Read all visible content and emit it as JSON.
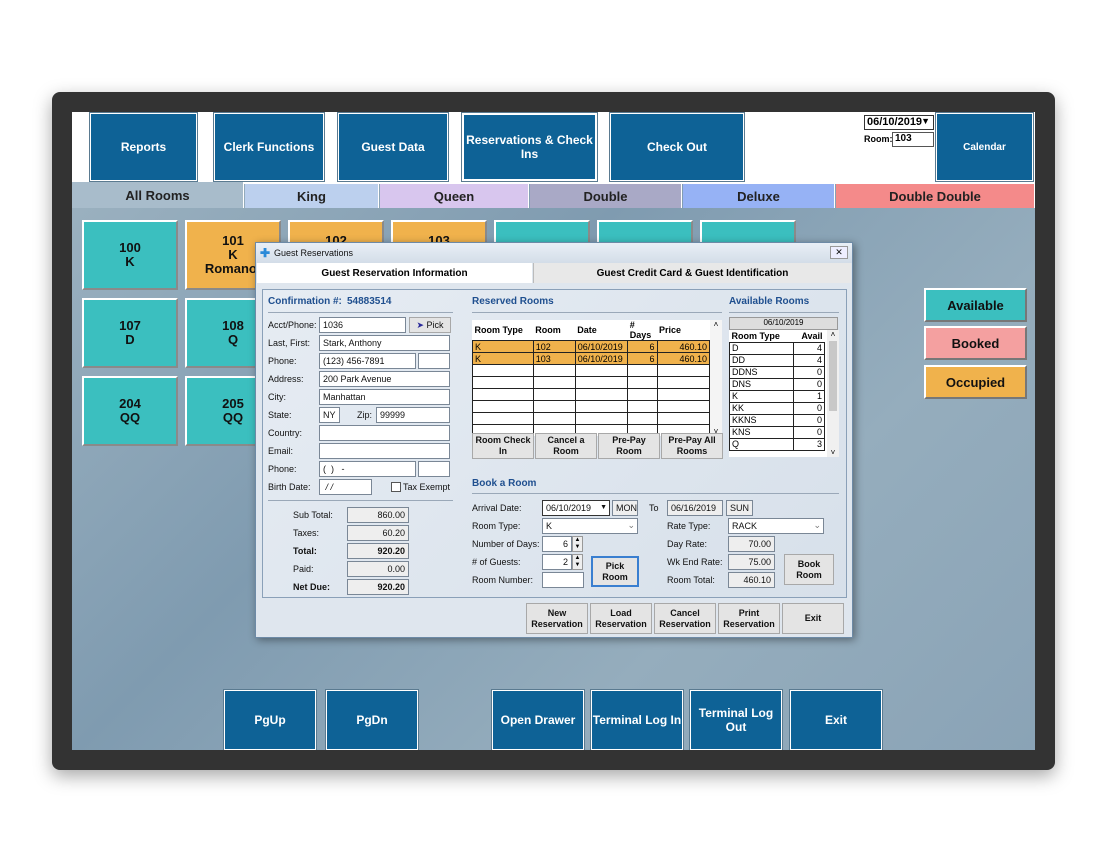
{
  "top_buttons": [
    "Reports",
    "Clerk Functions",
    "Guest Data",
    "Reservations & Check Ins",
    "Check Out"
  ],
  "date_select": "06/10/2019",
  "room_label": "Room:",
  "room_value": "103",
  "calendar": "Calendar",
  "tabs": [
    {
      "label": "All Rooms",
      "color": "#a8bccb"
    },
    {
      "label": "King",
      "color": "#bcd0ee"
    },
    {
      "label": "Queen",
      "color": "#d8c6ee"
    },
    {
      "label": "Double",
      "color": "#a9a9c6"
    },
    {
      "label": "Deluxe",
      "color": "#96b2f5"
    },
    {
      "label": "Double Double",
      "color": "#f48a8a"
    }
  ],
  "rooms": [
    {
      "number": "100",
      "type": "K",
      "guest": "",
      "status": "available"
    },
    {
      "number": "101",
      "type": "K",
      "guest": "Romanof",
      "status": "occupied"
    },
    {
      "number": "102",
      "type": "",
      "guest": "",
      "status": "occupied"
    },
    {
      "number": "103",
      "type": "",
      "guest": "",
      "status": "occupied"
    },
    {
      "number": "",
      "type": "",
      "guest": "",
      "status": "available"
    },
    {
      "number": "",
      "type": "",
      "guest": "",
      "status": "available"
    },
    {
      "number": "",
      "type": "",
      "guest": "",
      "status": "available"
    },
    {
      "number": "107",
      "type": "D",
      "guest": "",
      "status": "available"
    },
    {
      "number": "108",
      "type": "Q",
      "guest": "",
      "status": "available"
    },
    {
      "number": "204",
      "type": "QQ",
      "guest": "",
      "status": "available"
    },
    {
      "number": "205",
      "type": "QQ",
      "guest": "",
      "status": "available"
    }
  ],
  "legend": [
    {
      "label": "Available",
      "color": "#3bbfbf"
    },
    {
      "label": "Booked",
      "color": "#f4a0a0"
    },
    {
      "label": "Occupied",
      "color": "#f0b24c"
    }
  ],
  "bottom_buttons": [
    "PgUp",
    "PgDn",
    "Open Drawer",
    "Terminal Log In",
    "Terminal Log Out",
    "Exit"
  ],
  "dialog": {
    "title": "Guest Reservations",
    "tabs": [
      "Guest Reservation Information",
      "Guest Credit Card & Guest Identification"
    ],
    "confirmation_label": "Confirmation #:",
    "confirmation": "54883514",
    "fields": {
      "acct_label": "Acct/Phone:",
      "acct": "1036",
      "pick": "Pick",
      "name_label": "Last, First:",
      "name": "Stark, Anthony",
      "phone_label": "Phone:",
      "phone": "(123) 456-7891",
      "address_label": "Address:",
      "address": "200 Park Avenue",
      "city_label": "City:",
      "city": "Manhattan",
      "state_label": "State:",
      "state": "NY",
      "zip_label": "Zip:",
      "zip": "99999",
      "country_label": "Country:",
      "country": "",
      "email_label": "Email:",
      "email": "",
      "phone2_label": "Phone:",
      "phone2": "(  )   -",
      "birth_label": "Birth Date:",
      "birth": " / /",
      "tax_exempt": "Tax Exempt",
      "tax_exempt_checked": false
    },
    "totals": [
      {
        "label": "Sub Total:",
        "value": "860.00",
        "bold": false
      },
      {
        "label": "Taxes:",
        "value": "60.20",
        "bold": false
      },
      {
        "label": "Total:",
        "value": "920.20",
        "bold": true
      },
      {
        "label": "Paid:",
        "value": "0.00",
        "bold": false
      },
      {
        "label": "Net Due:",
        "value": "920.20",
        "bold": true
      }
    ],
    "reserved": {
      "title": "Reserved Rooms",
      "headers": [
        "Room Type",
        "Room",
        "Date",
        "# Days",
        "Price"
      ],
      "rows": [
        [
          "K",
          "102",
          "06/10/2019",
          "6",
          "460.10"
        ],
        [
          "K",
          "103",
          "06/10/2019",
          "6",
          "460.10"
        ]
      ],
      "buttons": [
        "Room Check In",
        "Cancel a Room",
        "Pre-Pay Room",
        "Pre-Pay All Rooms"
      ]
    },
    "available": {
      "title": "Available Rooms",
      "date": "06/10/2019",
      "headers": [
        "Room Type",
        "Avail"
      ],
      "rows": [
        [
          "D",
          "4"
        ],
        [
          "DD",
          "4"
        ],
        [
          "DDNS",
          "0"
        ],
        [
          "DNS",
          "0"
        ],
        [
          "K",
          "1"
        ],
        [
          "KK",
          "0"
        ],
        [
          "KKNS",
          "0"
        ],
        [
          "KNS",
          "0"
        ],
        [
          "Q",
          "3"
        ]
      ]
    },
    "book": {
      "title": "Book a Room",
      "arrival_label": "Arrival Date:",
      "arrival": "06/10/2019",
      "arrival_day": "MON",
      "to_label": "To",
      "departure": "06/16/2019",
      "departure_day": "SUN",
      "room_type_label": "Room Type:",
      "room_type": "K",
      "rate_type_label": "Rate Type:",
      "rate_type": "RACK",
      "days_label": "Number of Days:",
      "days": "6",
      "day_rate_label": "Day Rate:",
      "day_rate": "70.00",
      "guests_label": "# of Guests:",
      "guests": "2",
      "wk_end_label": "Wk End Rate:",
      "wk_end_rate": "75.00",
      "room_number_label": "Room Number:",
      "room_number": "",
      "room_total_label": "Room Total:",
      "room_total": "460.10",
      "pick_room": "Pick Room",
      "book_room": "Book Room"
    },
    "footer_buttons": [
      "New Reservation",
      "Load Reservation",
      "Cancel Reservation",
      "Print Reservation",
      "Exit"
    ]
  }
}
